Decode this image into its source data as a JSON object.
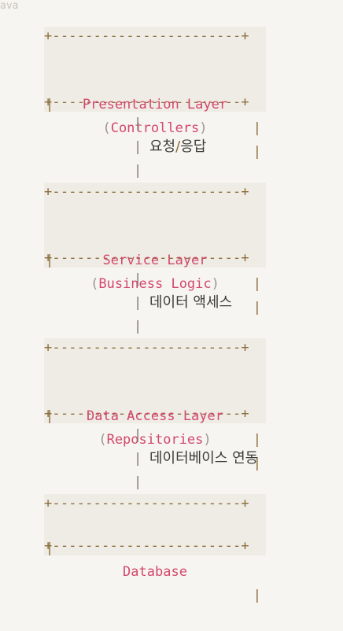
{
  "lang_tag": "ava",
  "border": "+-----------------------+",
  "pipe": "|",
  "layers": [
    {
      "title": "Presentation Layer",
      "sub": "Controllers"
    },
    {
      "title": "Service Layer",
      "sub": "Business Logic"
    },
    {
      "title": "Data Access Layer",
      "sub": "Repositories"
    },
    {
      "title": "Database",
      "sub": ""
    }
  ],
  "connectors": [
    {
      "note_a": "요청",
      "sep": "/",
      "note_b": "응답"
    },
    {
      "note_a": "데이터 액세스",
      "sep": "",
      "note_b": ""
    },
    {
      "note_a": "데이터베이스 연동",
      "sep": "",
      "note_b": ""
    }
  ],
  "paren_open": "(",
  "paren_close": ")"
}
